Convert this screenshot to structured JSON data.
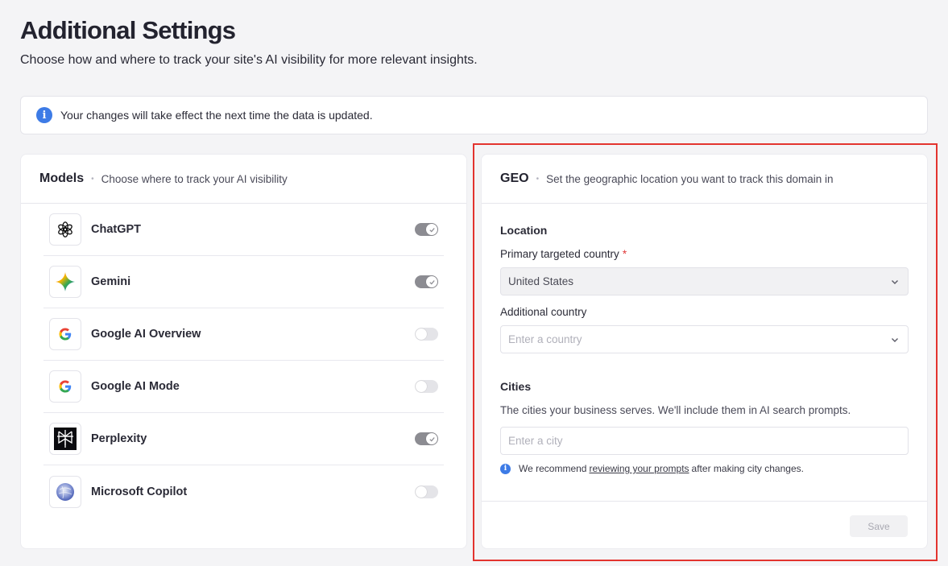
{
  "page": {
    "title": "Additional Settings",
    "subtitle": "Choose how and where to track your site's AI visibility for more relevant insights."
  },
  "banner": {
    "text": "Your changes will take effect the next time the data is updated.",
    "icon": "info-icon"
  },
  "models": {
    "title": "Models",
    "description": "Choose where to track your AI visibility",
    "items": [
      {
        "label": "ChatGPT",
        "enabled": true,
        "icon": "chatgpt-logo-icon"
      },
      {
        "label": "Gemini",
        "enabled": true,
        "icon": "gemini-logo-icon"
      },
      {
        "label": "Google AI Overview",
        "enabled": false,
        "icon": "google-logo-icon"
      },
      {
        "label": "Google AI Mode",
        "enabled": false,
        "icon": "google-logo-icon"
      },
      {
        "label": "Perplexity",
        "enabled": true,
        "icon": "perplexity-logo-icon"
      },
      {
        "label": "Microsoft Copilot",
        "enabled": false,
        "icon": "copilot-logo-icon"
      }
    ]
  },
  "geo": {
    "title": "GEO",
    "description": "Set the geographic location you want to track this domain in",
    "location_label": "Location",
    "primary_country_label": "Primary targeted country",
    "required_marker": "*",
    "primary_country_value": "United States",
    "additional_country_label": "Additional country",
    "additional_country_placeholder": "Enter a country",
    "cities_label": "Cities",
    "cities_helper": "The cities your business serves. We'll include them in AI search prompts.",
    "city_placeholder": "Enter a city",
    "note_prefix": "We recommend",
    "note_link": "reviewing your prompts",
    "note_suffix": "after making city changes.",
    "save_label": "Save"
  },
  "colors": {
    "accent_blue": "#3d7be6",
    "highlight_red": "#e3342f",
    "toggle_on": "#8c8c92",
    "toggle_off": "#e4e4e8"
  }
}
